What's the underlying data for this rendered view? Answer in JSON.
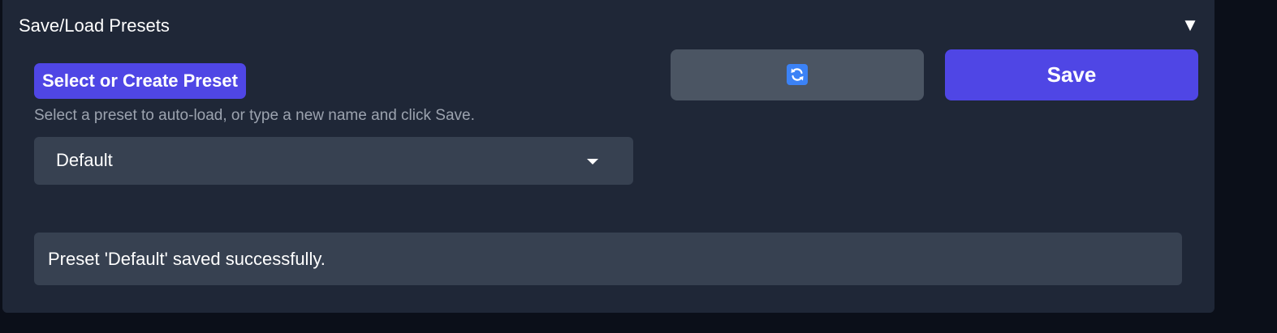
{
  "panel": {
    "title": "Save/Load Presets",
    "collapse_icon": "▼"
  },
  "preset": {
    "label": "Select or Create Preset",
    "hint": "Select a preset to auto-load, or type a new name and click Save.",
    "selected_value": "Default"
  },
  "actions": {
    "refresh_icon": "refresh-icon",
    "save_label": "Save"
  },
  "status": {
    "message": "Preset 'Default' saved successfully."
  },
  "colors": {
    "accent": "#4f46e5",
    "panel_bg": "#1f2737",
    "input_bg": "#374151",
    "secondary_button": "#4b5563",
    "refresh_icon_bg": "#3b82f6"
  }
}
